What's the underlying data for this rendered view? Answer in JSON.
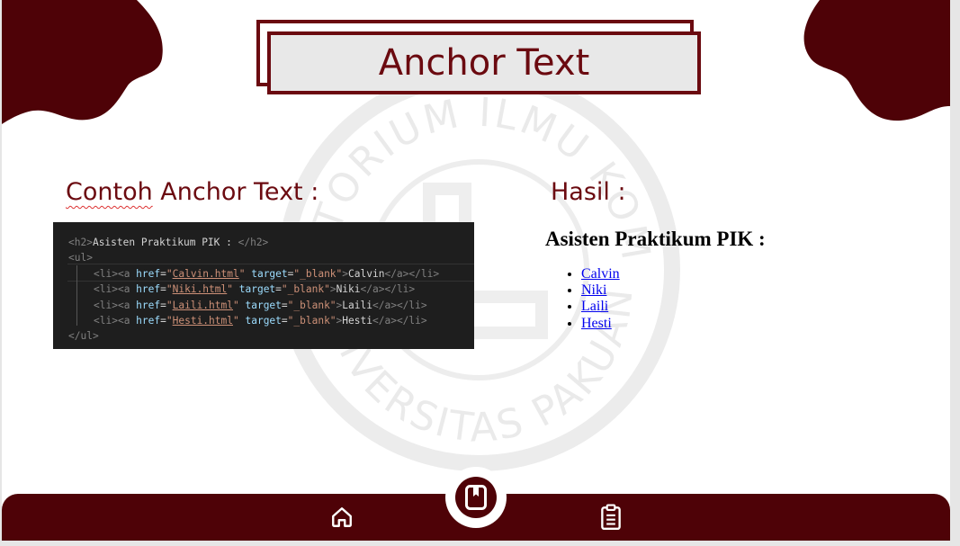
{
  "slide": {
    "title": "Anchor Text",
    "left_heading": "Contoh Anchor Text :",
    "right_heading": "Hasil :",
    "watermark_text_top": "LABORATORIUM ILMU KOMPUTER",
    "watermark_text_bottom": "UNIVERSITAS PAKUAN"
  },
  "code": {
    "h2_open": "<h2>",
    "h2_text": "Asisten Praktikum PIK : ",
    "h2_close": "</h2>",
    "ul_open": "<ul>",
    "ul_close": "</ul>",
    "li_open": "<li>",
    "a_open": "<a ",
    "href_attr": "href",
    "target_attr": "target",
    "eq": "=",
    "quote": "\"",
    "blank": "\"_blank\"",
    "gt": ">",
    "a_close": "</a>",
    "li_close": "</li>",
    "items": [
      {
        "file": "Calvin.html",
        "text": "Calvin"
      },
      {
        "file": "Niki.html",
        "text": "Niki"
      },
      {
        "file": "Laili.html",
        "text": "Laili"
      },
      {
        "file": "Hesti.html",
        "text": "Hesti"
      }
    ]
  },
  "result": {
    "heading": "Asisten Praktikum PIK :",
    "links": [
      "Calvin",
      "Niki",
      "Laili",
      "Hesti"
    ]
  },
  "nav": {
    "home_icon": "home-icon",
    "bookmark_icon": "bookmark-icon",
    "clipboard_icon": "clipboard-icon"
  },
  "colors": {
    "maroon": "#6b0a10",
    "footer": "#4e0207",
    "link": "#0000ee"
  }
}
